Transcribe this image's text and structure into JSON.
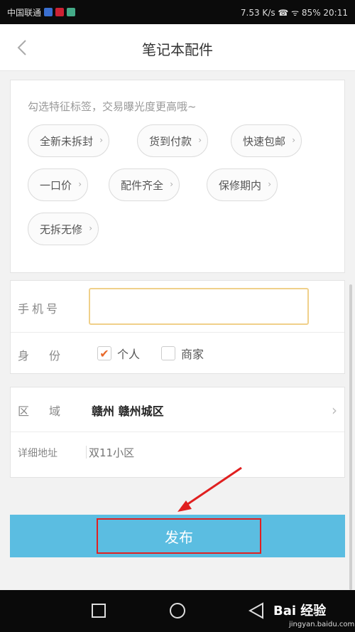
{
  "status_bar": {
    "left_text": "中国联通",
    "right_text": "7.53 K/s  ☎ ᯤ 85%  20:11"
  },
  "header": {
    "title": "笔记本配件"
  },
  "tags": {
    "hint": "勾选特征标签，交易曝光度更高哦~",
    "items": [
      "全新未拆封",
      "货到付款",
      "快速包邮",
      "一口价",
      "配件齐全",
      "保修期内",
      "无拆无修"
    ]
  },
  "form": {
    "phone_label": "手机号",
    "phone_value": "",
    "identity_label": "身份",
    "identity_options": [
      "个人",
      "商家"
    ],
    "region_label": "区域",
    "region_value": "赣州 赣州城区",
    "address_label": "详细地址",
    "address_placeholder": "双11小区"
  },
  "actions": {
    "publish_label": "发布"
  },
  "watermark": {
    "logo": "Bai 经验",
    "url": "jingyan.baidu.com"
  },
  "colors": {
    "publish_bg": "#5bbde1",
    "highlight_red": "#e02020",
    "checkbox_check": "#e8692b"
  }
}
